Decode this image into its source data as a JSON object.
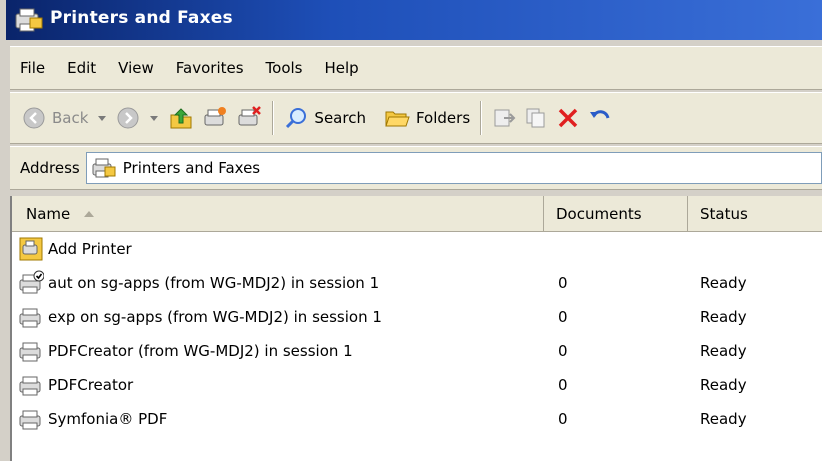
{
  "window": {
    "title": "Printers and Faxes"
  },
  "menu": {
    "items": [
      "File",
      "Edit",
      "View",
      "Favorites",
      "Tools",
      "Help"
    ]
  },
  "toolbar": {
    "back_label": "Back",
    "search_label": "Search",
    "folders_label": "Folders"
  },
  "address": {
    "label": "Address",
    "value": "Printers and Faxes"
  },
  "list": {
    "columns": {
      "name": "Name",
      "documents": "Documents",
      "status": "Status"
    },
    "rows": [
      {
        "name": "Add Printer",
        "documents": "",
        "status": "",
        "icon": "add-printer-icon"
      },
      {
        "name": "aut on sg-apps (from WG-MDJ2) in session 1",
        "documents": "0",
        "status": "Ready",
        "icon": "default-printer-icon"
      },
      {
        "name": "exp on sg-apps (from WG-MDJ2) in session 1",
        "documents": "0",
        "status": "Ready",
        "icon": "printer-icon"
      },
      {
        "name": "PDFCreator (from WG-MDJ2) in session 1",
        "documents": "0",
        "status": "Ready",
        "icon": "printer-icon"
      },
      {
        "name": "PDFCreator",
        "documents": "0",
        "status": "Ready",
        "icon": "printer-icon"
      },
      {
        "name": "Symfonia® PDF",
        "documents": "0",
        "status": "Ready",
        "icon": "printer-icon"
      }
    ]
  },
  "colors": {
    "title_bar_start": "#0a246a",
    "title_bar_end": "#3a6fd8",
    "chrome": "#ece9d8",
    "delete_red": "#e02020"
  }
}
